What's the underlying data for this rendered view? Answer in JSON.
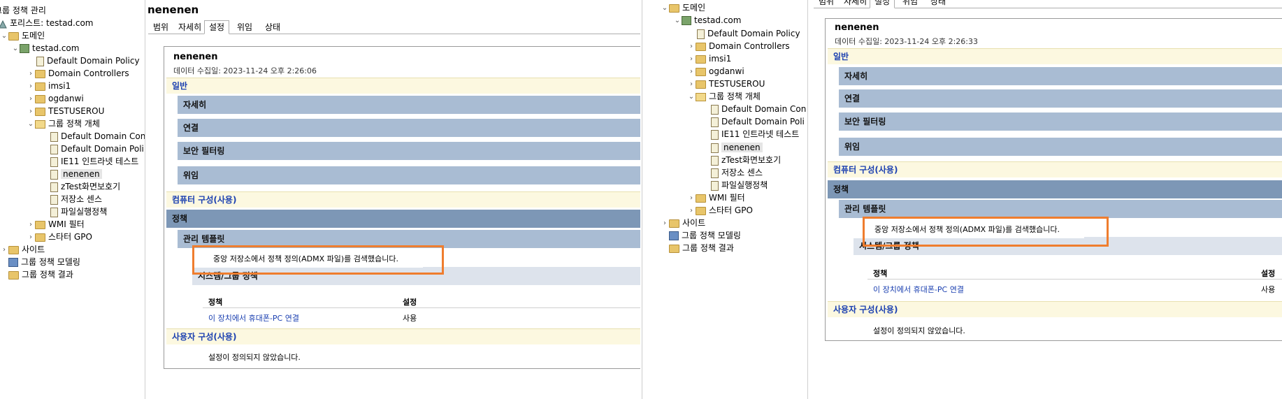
{
  "left": {
    "tree": {
      "root": "그룹 정책 관리",
      "forest": "포리스트: testad.com",
      "domains": "도메인",
      "domain": "testad.com",
      "ddp": "Default Domain Policy",
      "dc": "Domain Controllers",
      "imsi1": "imsi1",
      "ogdanwi": "ogdanwi",
      "testuserou": "TESTUSEROU",
      "gpo_objects": "그룹 정책 개체",
      "gpo_ddc": "Default Domain Con",
      "gpo_ddp": "Default Domain Poli",
      "gpo_ie11": "IE11 인트라넷 테스트",
      "gpo_nenenen": "nenenen",
      "gpo_ztest": "zTest화면보호기",
      "gpo_storage": "저장소 센스",
      "gpo_fileexec": "파일실행정책",
      "wmi": "WMI 필터",
      "starter": "스타터 GPO",
      "sites": "사이트",
      "modeling": "그룹 정책 모델링",
      "results": "그룹 정책 결과"
    },
    "title": "nenenen",
    "tabs": [
      "범위",
      "자세히",
      "설정",
      "위임",
      "상태"
    ],
    "report": {
      "name": "nenenen",
      "collected": "데이터 수집일: 2023-11-24 오후 2:26:06",
      "general": "일반",
      "details": "자세히",
      "links": "연결",
      "security": "보안 필터링",
      "delegation": "위임",
      "computer": "컴퓨터 구성(사용)",
      "policy": "정책",
      "admin_tpl": "관리 템플릿",
      "notice": "중앙 저장소에서 정책 정의(ADMX 파일)를 검색했습니다.",
      "system_group": "시스템/그룹 정책",
      "col_policy": "정책",
      "col_setting": "설정",
      "row_policy": "이 장치에서 휴대폰-PC 연결",
      "row_setting": "사용",
      "user": "사용자 구성(사용)",
      "not_defined": "설정이 정의되지 않았습니다."
    }
  },
  "right": {
    "tree": {
      "domains": "도메인",
      "domain": "testad.com",
      "ddp": "Default Domain Policy",
      "dc": "Domain Controllers",
      "imsi1": "imsi1",
      "ogdanwi": "ogdanwi",
      "testuserou": "TESTUSEROU",
      "gpo_objects": "그룹 정책 개체",
      "gpo_ddc": "Default Domain Con",
      "gpo_ddp": "Default Domain Poli",
      "gpo_ie11": "IE11 인트라넷 테스트",
      "gpo_nenenen": "nenenen",
      "gpo_ztest": "zTest화면보호기",
      "gpo_storage": "저장소 센스",
      "gpo_fileexec": "파일실행정책",
      "wmi": "WMI 필터",
      "starter": "스타터 GPO",
      "sites": "사이트",
      "modeling": "그룹 정책 모델링",
      "results": "그룹 정책 결과"
    },
    "tabs": [
      "범위",
      "자세히",
      "설정",
      "위임",
      "상태"
    ],
    "report": {
      "name": "nenenen",
      "collected": "데이터 수집일: 2023-11-24 오후 2:26:33",
      "general": "일반",
      "details": "자세히",
      "links": "연결",
      "security": "보안 필터링",
      "delegation": "위임",
      "computer": "컴퓨터 구성(사용)",
      "policy": "정책",
      "admin_tpl": "관리 템플릿",
      "notice": "중앙 저장소에서 정책 정의(ADMX 파일)를 검색했습니다.",
      "system_group": "시스템/그룹 정책",
      "col_policy": "정책",
      "col_setting": "설정",
      "row_policy": "이 장치에서 휴대폰-PC 연결",
      "row_setting": "사용",
      "user": "사용자 구성(사용)",
      "not_defined": "설정이 정의되지 않았습니다."
    }
  },
  "colors": {
    "highlight_box": "#ef7d2e",
    "section_yellow": "#fcf8e0",
    "section_blue": "#a9bcd3",
    "section_dark": "#7d97b6",
    "link": "#1a3fb0"
  }
}
